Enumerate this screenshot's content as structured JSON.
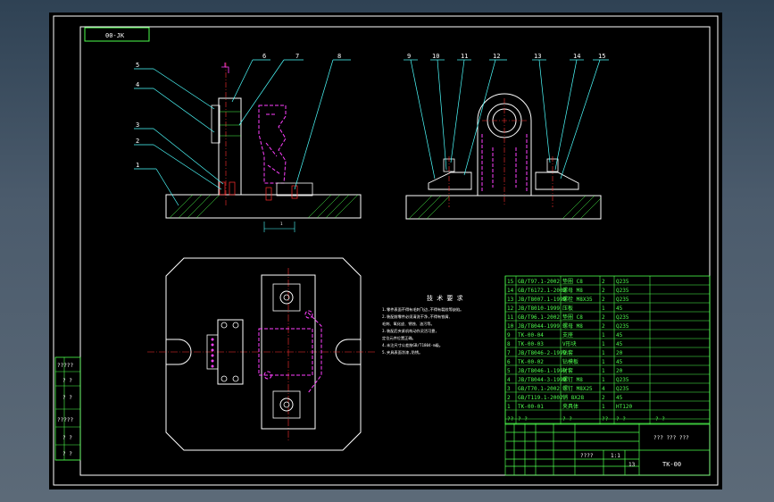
{
  "drawing": {
    "code_box": "00-JK",
    "title_code": "TK-00",
    "title_name": "??? ??? ???",
    "title_scale_left": "????",
    "title_scale_mid": "1:1",
    "title_sheet_num": "13",
    "title_material": "HT120",
    "notes_title": "技 术 要 求",
    "notes": [
      "1.零件表面不得有毛刺飞边,不得有裂纹等缺陷。",
      "2.装配前零件必须清洗干净,不得有铁屑、",
      "毛刺、氧化皮、锈蚀、油污等。",
      "3.装配后夹紧机构动作灵活可靠,",
      "定位元件位置正确。",
      "4.未注尺寸公差按GB/T1804-m级。",
      "5.夹具表面涂漆,防锈。"
    ],
    "balloons_front": [
      "1",
      "2",
      "3",
      "4",
      "5",
      "6",
      "7",
      "8"
    ],
    "balloons_side": [
      "9",
      "10",
      "11",
      "12",
      "13",
      "14",
      "15"
    ],
    "bom": [
      {
        "no": "15",
        "std": "GB/T97.1-2002",
        "name": "垫圈 C8",
        "qty": "2",
        "mat": "Q235"
      },
      {
        "no": "14",
        "std": "GB/T6172.1-2002",
        "name": "螺母 M8",
        "qty": "2",
        "mat": "Q235"
      },
      {
        "no": "13",
        "std": "JB/T8007.1-1999",
        "name": "螺栓 M8X35",
        "qty": "2",
        "mat": "Q235"
      },
      {
        "no": "12",
        "std": "JB/T8010-1999",
        "name": "压板",
        "qty": "1",
        "mat": "45"
      },
      {
        "no": "11",
        "std": "GB/T96.1-2002",
        "name": "垫圈 C8",
        "qty": "2",
        "mat": "Q235"
      },
      {
        "no": "10",
        "std": "JB/T8044-1999",
        "name": "螺母 M8",
        "qty": "2",
        "mat": "Q235"
      },
      {
        "no": "9",
        "std": "TK-00-04",
        "name": "支座",
        "qty": "1",
        "mat": "45"
      },
      {
        "no": "8",
        "std": "TK-00-03",
        "name": "V形块",
        "qty": "1",
        "mat": "45"
      },
      {
        "no": "7",
        "std": "JB/T8046-2-1999",
        "name": "钻套",
        "qty": "1",
        "mat": "20"
      },
      {
        "no": "6",
        "std": "TK-00-02",
        "name": "钻模板",
        "qty": "1",
        "mat": "45"
      },
      {
        "no": "5",
        "std": "JB/T8046-1-1999",
        "name": "衬套",
        "qty": "1",
        "mat": "20"
      },
      {
        "no": "4",
        "std": "JB/T8044-3-1999",
        "name": "螺钉 M8",
        "qty": "1",
        "mat": "Q235"
      },
      {
        "no": "3",
        "std": "GB/T70.1-2002",
        "name": "螺钉 M8X25",
        "qty": "4",
        "mat": "Q235"
      },
      {
        "no": "2",
        "std": "GB/T119.1-2002",
        "name": "销 8X28",
        "qty": "2",
        "mat": "45"
      },
      {
        "no": "1",
        "std": "TK-00-01",
        "name": "夹具体",
        "qty": "1",
        "mat": "HT120"
      }
    ],
    "bom_header": {
      "no": "??",
      "std": "? ?",
      "name": "? ?",
      "qty": "??",
      "mat": "? ?",
      "extra": "? ?"
    },
    "left_strip": [
      "?????",
      "? ?",
      "? ?",
      "?????",
      "? ?",
      "? ?"
    ],
    "dim_label": "1",
    "colors": {
      "outline": "#ffffff",
      "part": "#ffffff",
      "hidden": "#ff40ff",
      "center": "#ff3030",
      "leader": "#4dffff",
      "table": "#4dff4d",
      "hatch": "#4dff4d"
    }
  }
}
